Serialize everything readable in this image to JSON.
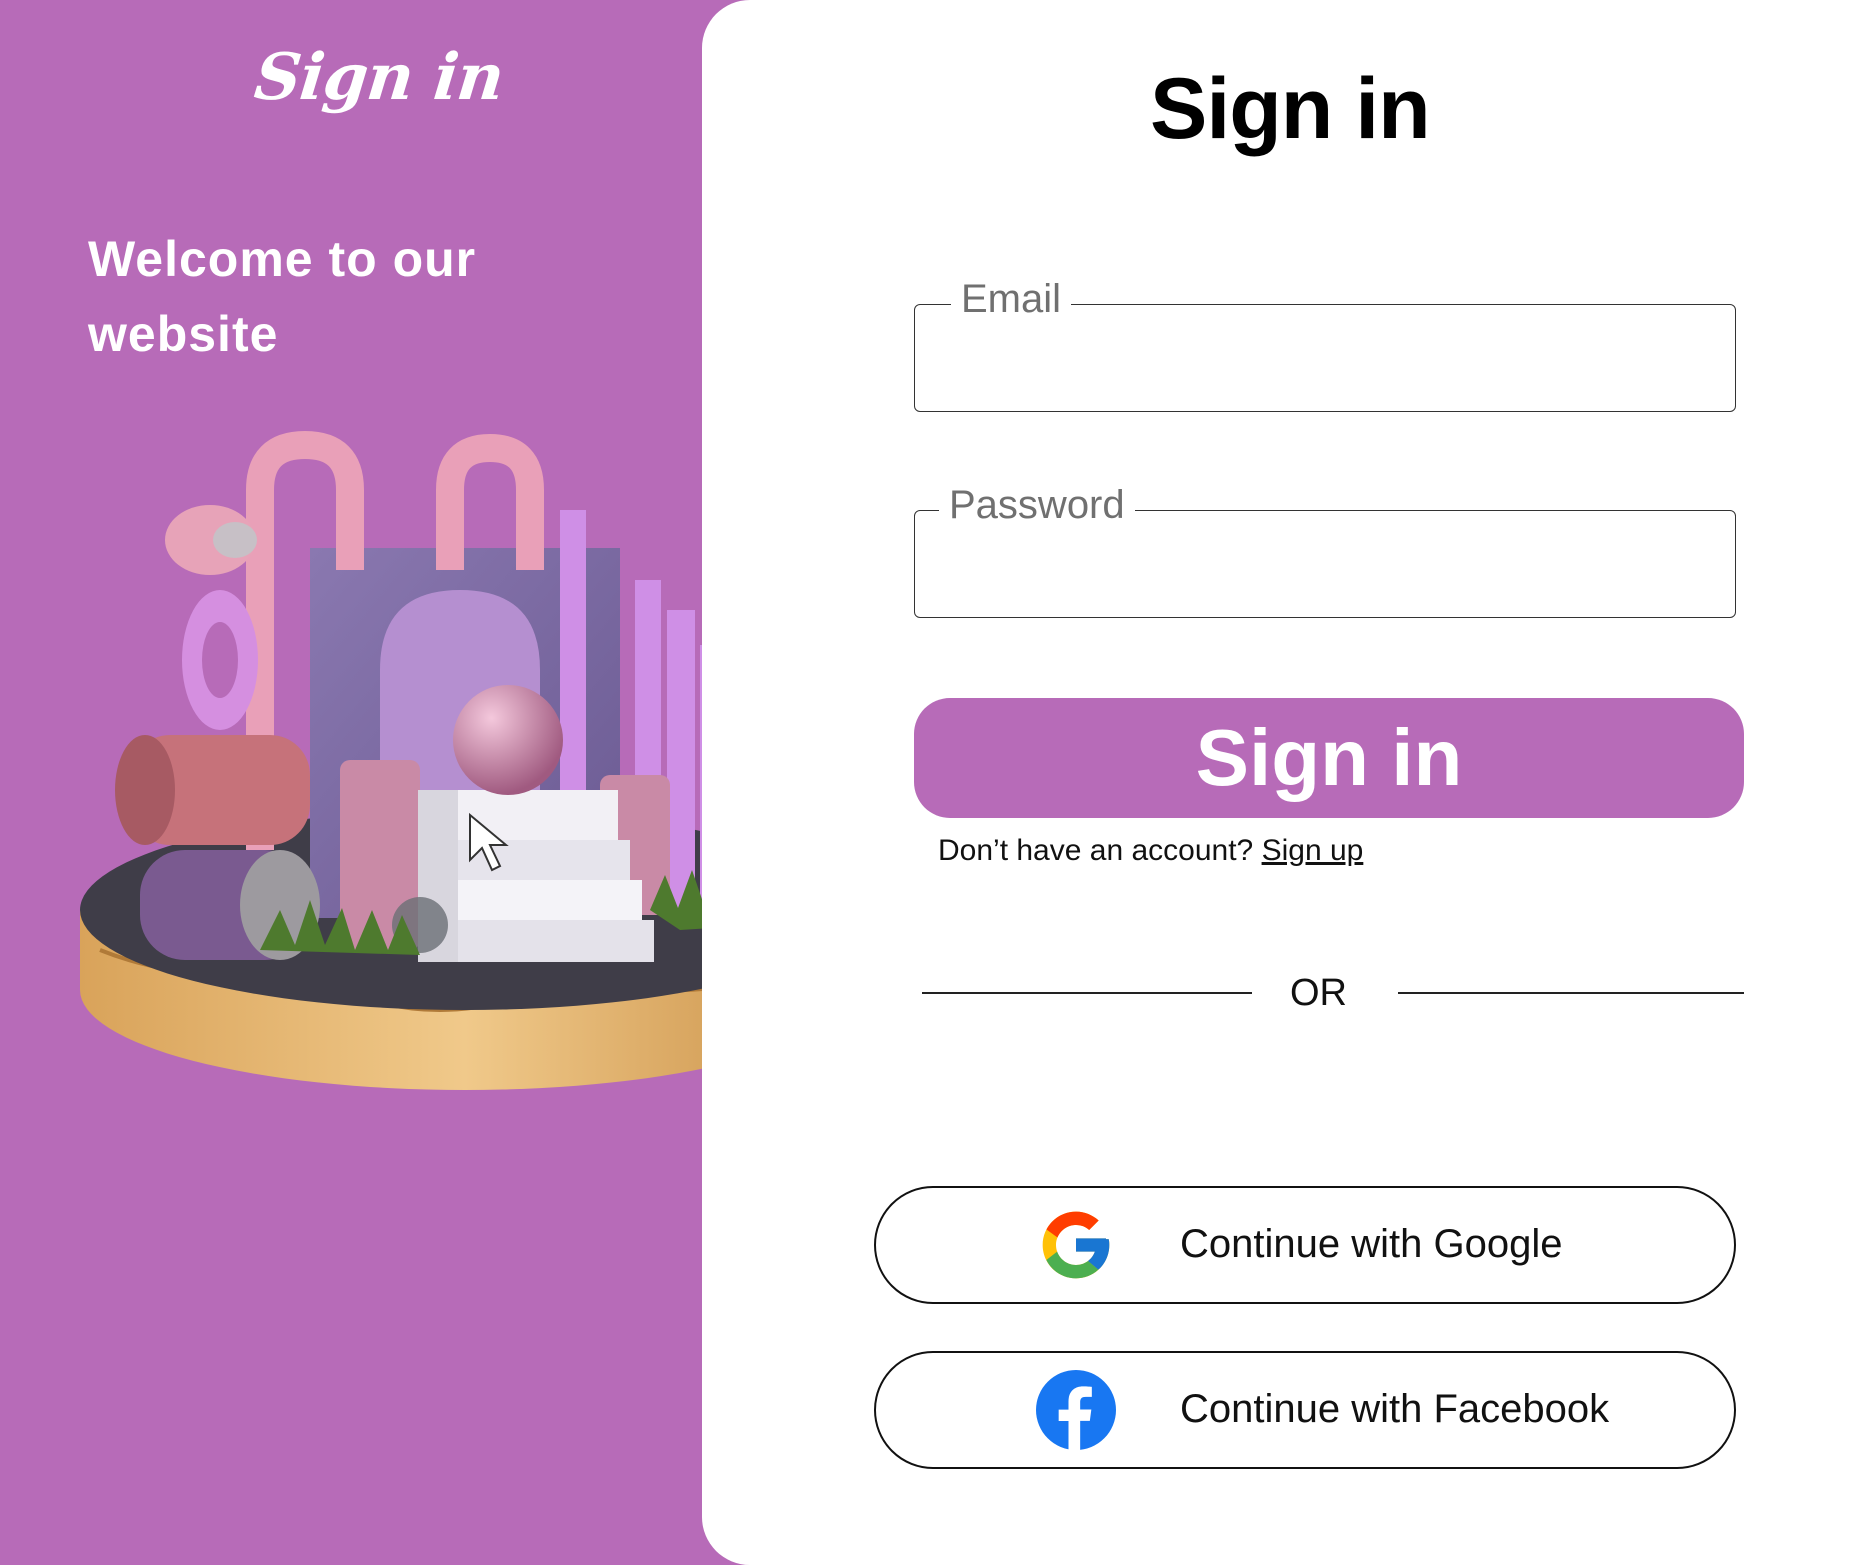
{
  "brand": {
    "title": "Sign in"
  },
  "welcome": {
    "text": "Welcome to our website"
  },
  "form": {
    "title": "Sign in",
    "email_label": "Email",
    "password_label": "Password",
    "email_value": "",
    "password_value": "",
    "submit_label": "Sign in",
    "account_prompt": "Don’t have an account?",
    "signup_link": "Sign up",
    "divider_text": "OR"
  },
  "social": {
    "google_label": "Continue with Google",
    "facebook_label": "Continue with Facebook",
    "google_icon": "google-icon",
    "facebook_icon": "facebook-icon"
  },
  "colors": {
    "accent": "#b76bb8",
    "panel_bg": "#ffffff",
    "text": "#111111"
  }
}
